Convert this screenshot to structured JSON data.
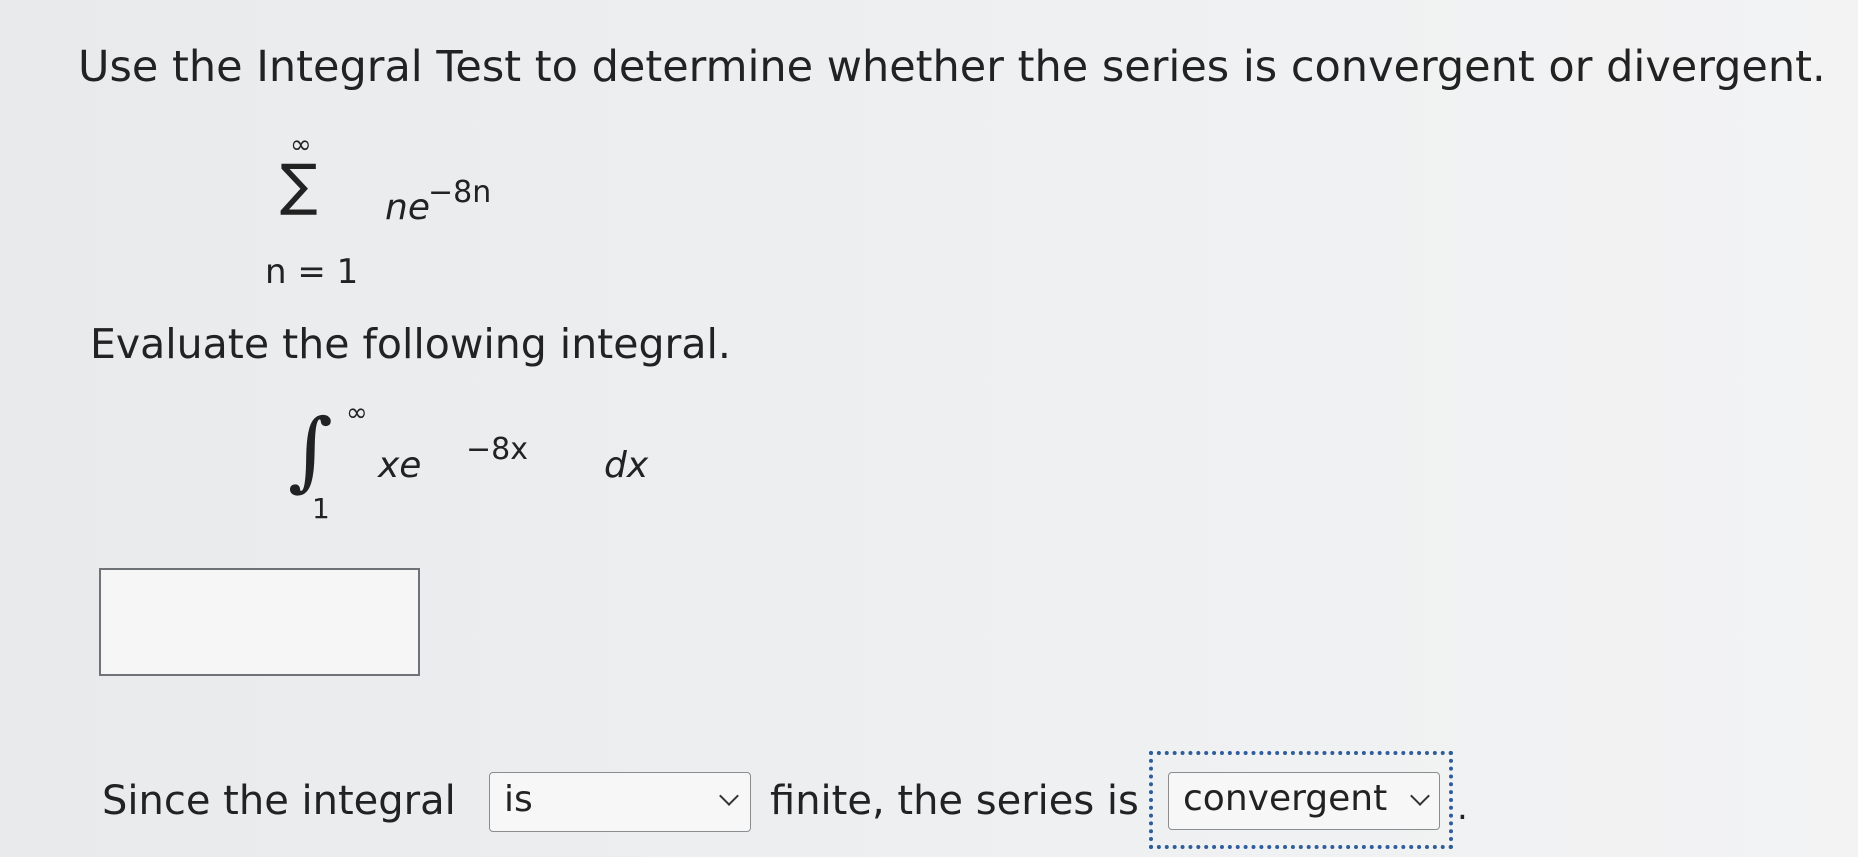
{
  "question": {
    "prompt": "Use the Integral Test to determine whether the series is convergent or divergent.",
    "series": {
      "sum_symbol": "∑",
      "upper_limit": "∞",
      "lower_limit": "n = 1",
      "term_base": "ne",
      "term_exponent": "−8n"
    },
    "evaluate_label": "Evaluate the following integral.",
    "integral": {
      "integral_symbol": "∫",
      "upper_limit": "∞",
      "lower_limit": "1",
      "integrand_base": "xe",
      "integrand_exponent": "−8x",
      "differential": "dx"
    },
    "answer_value": "",
    "conclusion": {
      "prefix": "Since the integral",
      "select_1_value": "is",
      "middle": "finite, the series is",
      "select_2_value": "convergent",
      "suffix": "."
    }
  }
}
